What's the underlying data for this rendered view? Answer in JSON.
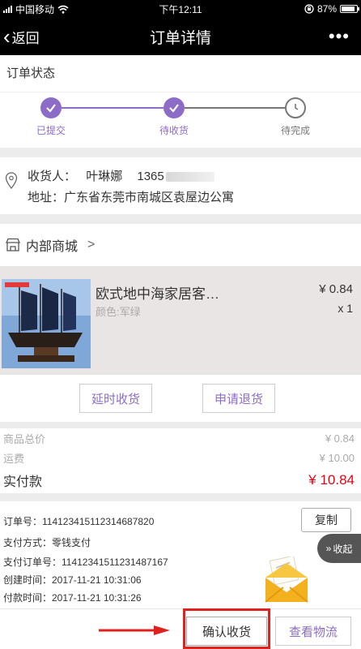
{
  "status_bar": {
    "carrier": "中国移动",
    "time": "下午12:11",
    "battery": "87%",
    "battery_level": 0.87,
    "icons": [
      "signal-icon",
      "wifi-icon",
      "lock-rotation-icon",
      "battery-icon"
    ]
  },
  "nav": {
    "back_label": "返回",
    "title": "订单详情",
    "more_label": "•••"
  },
  "order_status": {
    "heading": "订单状态",
    "steps": [
      {
        "label": "已提交",
        "state": "done"
      },
      {
        "label": "待收货",
        "state": "done"
      },
      {
        "label": "待完成",
        "state": "pending"
      }
    ],
    "colors": {
      "done": "#8d6cc7",
      "pending": "#777777"
    }
  },
  "address": {
    "recipient_label": "收货人：",
    "recipient_name": "叶琳娜",
    "phone_visible": "1365",
    "address_label": "地址：",
    "address_text": "广东省东莞市南城区袁屋边公寓"
  },
  "shop": {
    "name": "内部商城",
    "chevron": ">"
  },
  "product": {
    "name": "欧式地中海家居客…",
    "spec": "颜色:军绿",
    "price": "¥ 0.84",
    "qty": "x 1"
  },
  "actions": {
    "delay_label": "延时收货",
    "refund_label": "申请退货"
  },
  "totals": {
    "goods_label": "商品总价",
    "goods_value": "¥ 0.84",
    "shipping_label": "运费",
    "shipping_value": "¥ 10.00",
    "paid_label": "实付款",
    "paid_value": "¥ 10.84"
  },
  "order_info": {
    "order_no": "订单号：114123415112314687820",
    "payment_method": "支付方式：零钱支付",
    "pay_order_no": "支付订单号：11412341511231487167",
    "created_time": "创建时间：2017-11-21 10:31:06",
    "paid_time": "付款时间：2017-11-21 10:31:26",
    "copy_label": "复制"
  },
  "collapse_label": "收起",
  "bottom": {
    "confirm_label": "确认收货",
    "logistics_label": "查看物流"
  },
  "accent_color": "#8d6cc7",
  "price_color": "#e60012",
  "annotation_color": "#e0221e"
}
